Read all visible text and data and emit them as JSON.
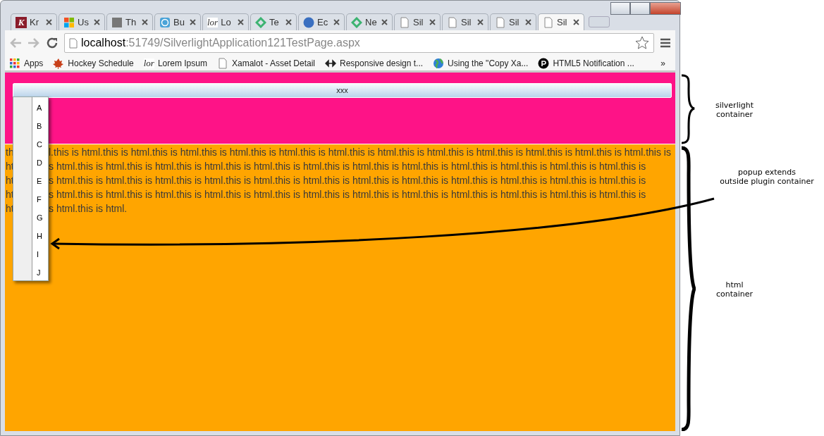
{
  "browser": {
    "tabs": [
      {
        "title": "Kr",
        "kind": "letter-logo",
        "icon_text": "K",
        "selected": false
      },
      {
        "title": "Us",
        "kind": "four-squares",
        "selected": false
      },
      {
        "title": "Th",
        "kind": "photo",
        "selected": false
      },
      {
        "title": "Bu",
        "kind": "circle-logo",
        "selected": false
      },
      {
        "title": "Lo",
        "kind": "text-logo",
        "icon_text": "lor",
        "selected": false
      },
      {
        "title": "Te",
        "kind": "green-logo",
        "selected": false
      },
      {
        "title": "Ec",
        "kind": "blue-shape",
        "selected": false
      },
      {
        "title": "Ne",
        "kind": "green-logo",
        "selected": false
      },
      {
        "title": "Sil",
        "kind": "page",
        "selected": false
      },
      {
        "title": "Sil",
        "kind": "page",
        "selected": false
      },
      {
        "title": "Sil",
        "kind": "page",
        "selected": false
      },
      {
        "title": "Sil",
        "kind": "page",
        "selected": true
      }
    ],
    "address": {
      "host": "localhost",
      "path": ":51749/SilverlightApplication121TestPage.aspx"
    },
    "bookmarks": [
      {
        "label": "Apps",
        "kind": "apps"
      },
      {
        "label": "Hockey Schedule",
        "kind": "leaf"
      },
      {
        "label": "Lorem Ipsum",
        "kind": "text-logo",
        "icon_text": "lor"
      },
      {
        "label": "Xamalot - Asset Detail",
        "kind": "page"
      },
      {
        "label": "Responsive design t...",
        "kind": "arrows"
      },
      {
        "label": "Using the \"Copy Xa...",
        "kind": "globe"
      },
      {
        "label": "HTML5 Notification ...",
        "kind": "dark-circle"
      }
    ],
    "bookmarks_overflow": "»"
  },
  "silverlight": {
    "button": "xxx",
    "popup_items": [
      "A",
      "B",
      "C",
      "D",
      "E",
      "F",
      "G",
      "H",
      "I",
      "J"
    ]
  },
  "html_lines": [
    {
      "left": "th",
      "right": "l.this is html.this is html.this is html.this is html.this is html.this is html.this is html.this is html.this is html.this is html.this is html.this is html.this is"
    },
    {
      "left": "ht",
      "right": "s html.this is html.this is html.this is html.this is html.this is html.this is html.this is html.this is html.this is html.this is html.this is html.this is"
    },
    {
      "left": "ht",
      "right": "s html.this is html.this is html.this is html.this is html.this is html.this is html.this is html.this is html.this is html.this is html.this is html.this is"
    },
    {
      "left": "ht",
      "right": "s html.this is html.this is html.this is html.this is html.this is html.this is html.this is html.this is html.this is html.this is html.this is html.this is"
    },
    {
      "left": "ht",
      "right": "s html.this is html."
    }
  ],
  "annotations": {
    "silverlight_label": "silverlight\ncontainer",
    "popup_label": "popup extends\noutside plugin container",
    "html_label": "html\ncontainer"
  }
}
